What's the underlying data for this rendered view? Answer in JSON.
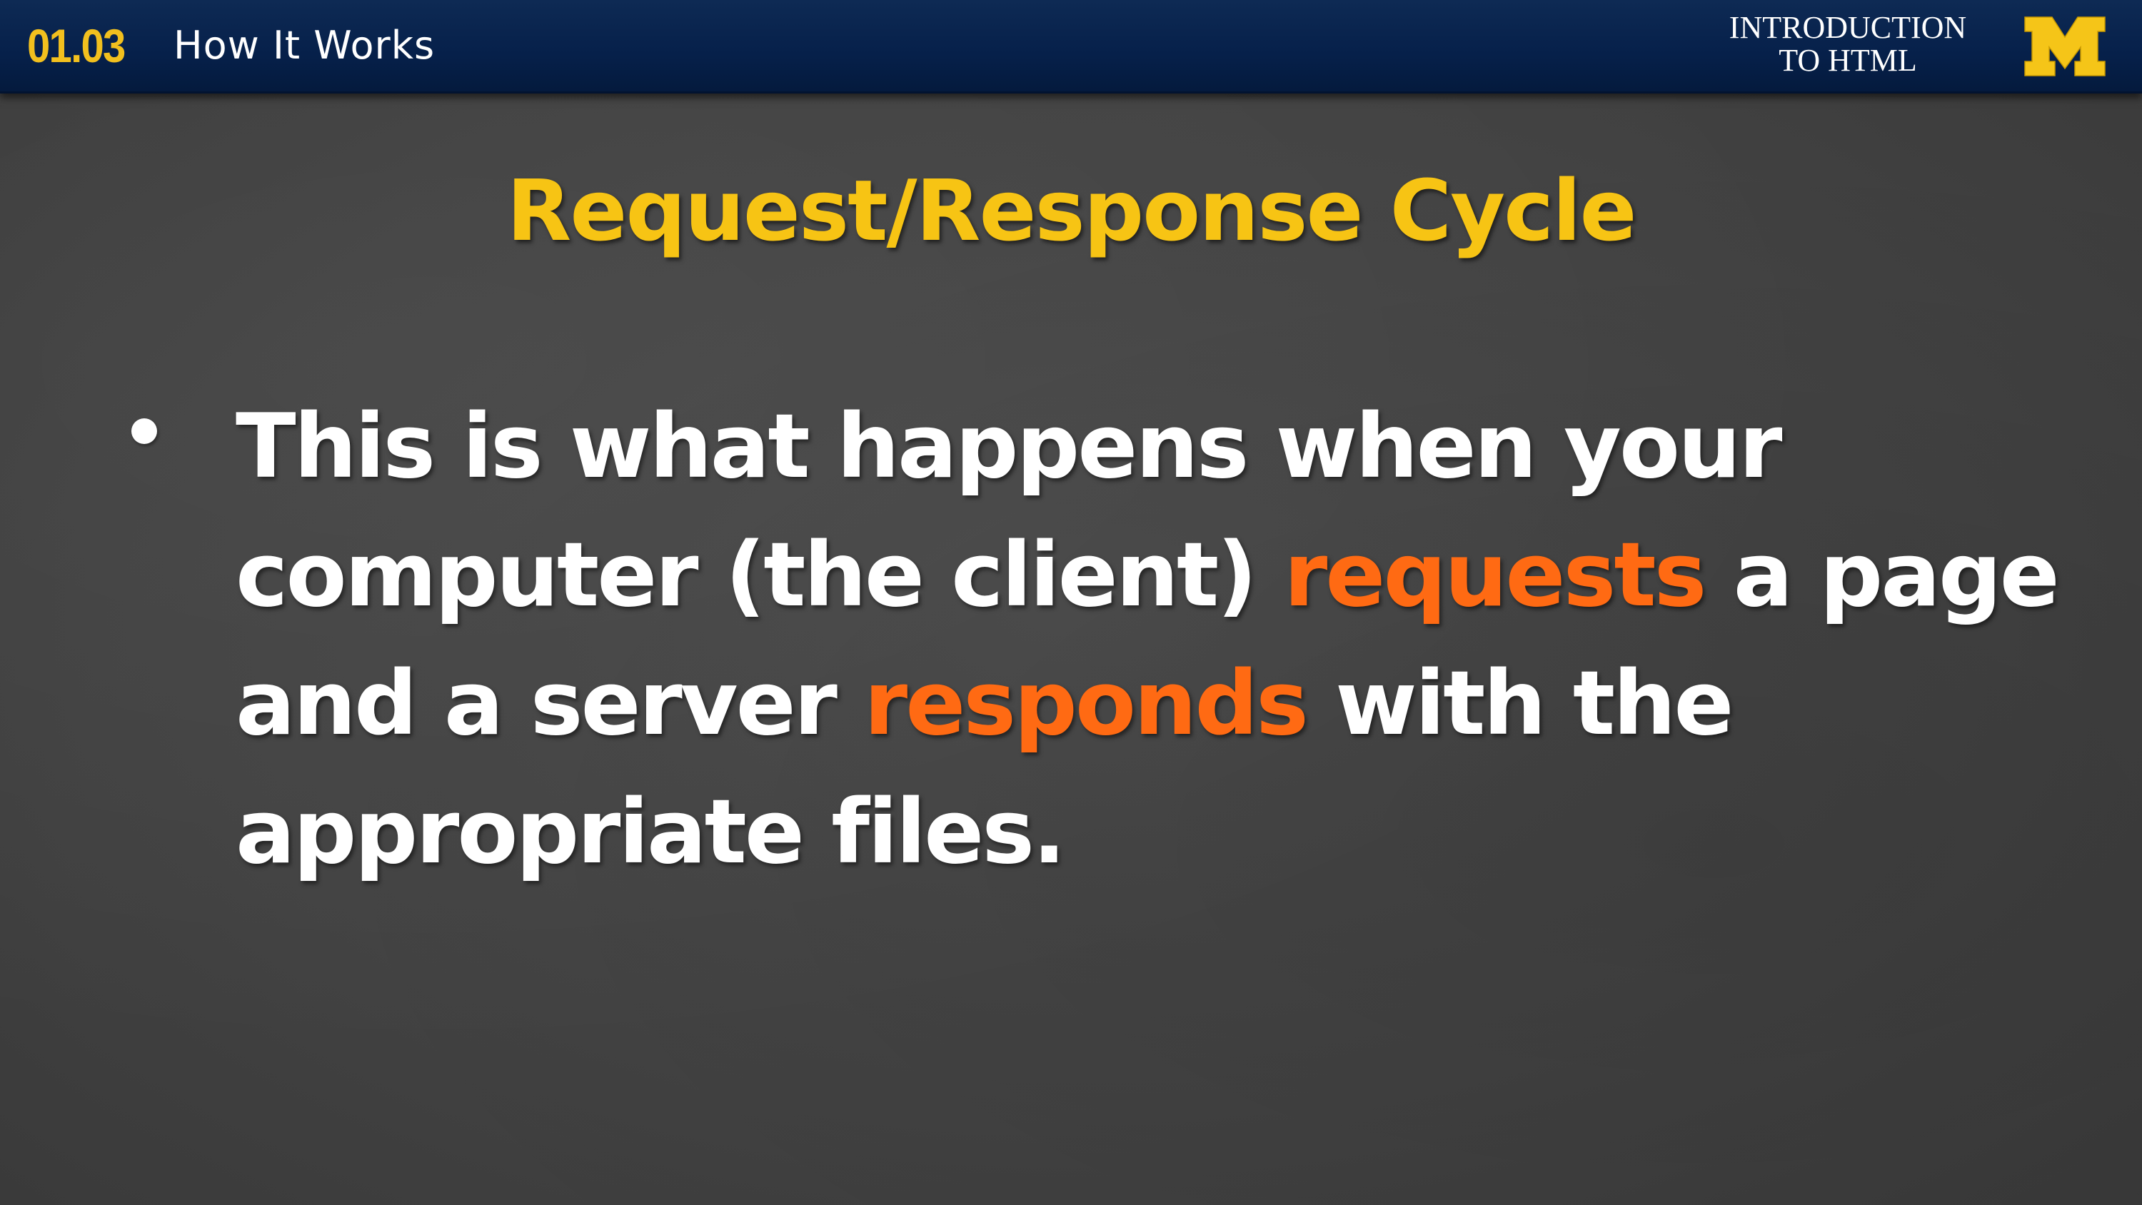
{
  "header": {
    "lesson_number": "01.03",
    "lesson_title": "How It Works",
    "course_title_line1": "INTRODUCTION",
    "course_title_line2": "TO HTML",
    "logo_icon": "block-m-logo-icon",
    "bar_color": "#06204a",
    "accent_color": "#f2c01e"
  },
  "slide": {
    "heading": "Request/Response Cycle",
    "heading_color": "#f7c414",
    "highlight_color": "#ff6a13",
    "bullet": {
      "line1": "This is what happens when your",
      "line2_start": "computer (the client) ",
      "line2_highlight": "requests",
      "line2_end": " a page",
      "line3_start": "and a server ",
      "line3_highlight": "responds",
      "line3_end": " with the",
      "line4": "appropriate files."
    }
  }
}
